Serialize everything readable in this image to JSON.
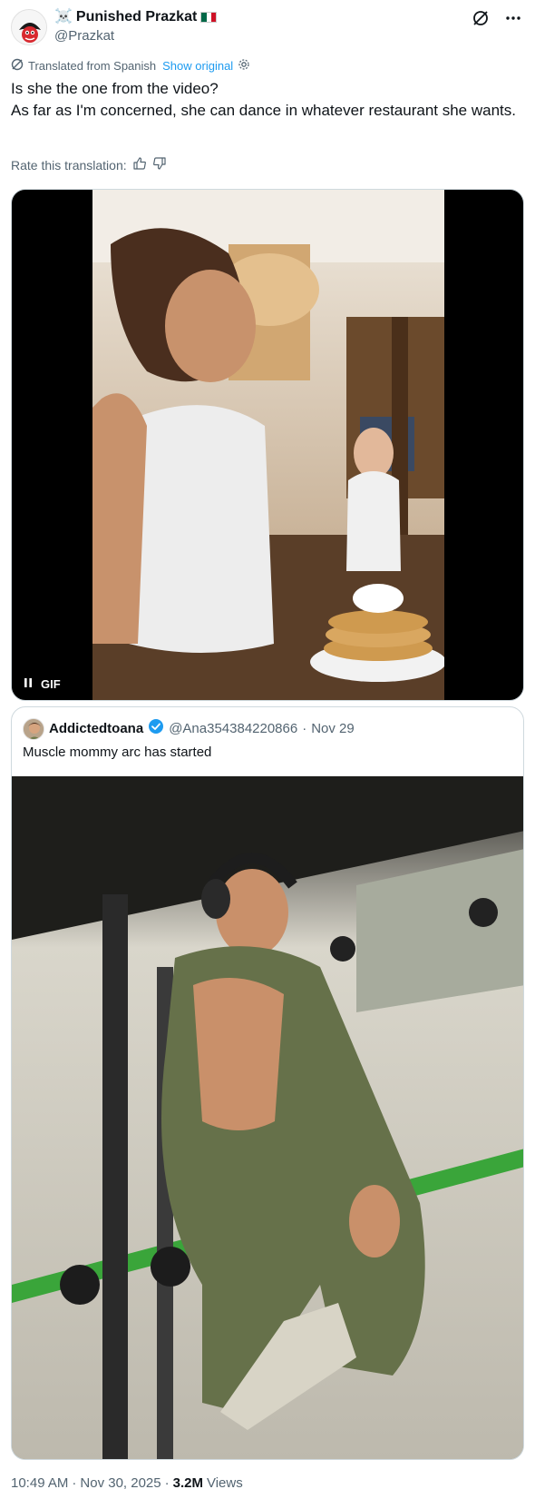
{
  "author": {
    "display_name": "Punished Prazkat",
    "emoji": "☠️",
    "handle": "@Prazkat",
    "flag": "mexico-flag"
  },
  "translation": {
    "label": "Translated from Spanish",
    "show_original": "Show original"
  },
  "tweet": {
    "line1": "Is she the one from the video?",
    "line2": "As far as I'm concerned, she can dance in whatever restaurant she wants."
  },
  "rate": {
    "label": "Rate this translation:"
  },
  "gif": {
    "badge": "GIF"
  },
  "quoted": {
    "display_name": "Addictedtoana",
    "handle": "@Ana354384220866",
    "separator": "·",
    "date": "Nov 29",
    "text": "Muscle mommy arc has started"
  },
  "footer": {
    "time": "10:49 AM",
    "sep1": "·",
    "date": "Nov 30, 2025",
    "sep2": "·",
    "views_count": "3.2M",
    "views_label": "Views"
  },
  "colors": {
    "accent": "#1d9bf0",
    "secondary_text": "#536471",
    "verified": "#1d9bf0"
  }
}
